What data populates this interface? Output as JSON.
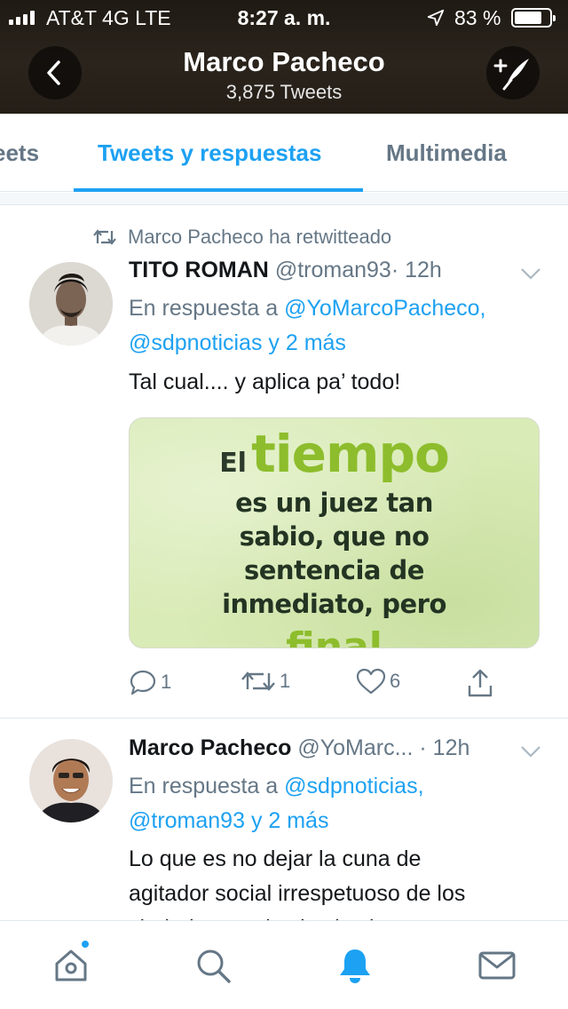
{
  "status_bar": {
    "carrier": "AT&T 4G  LTE",
    "time": "8:27 a. m.",
    "battery": "83 %",
    "battery_level": 0.83
  },
  "header": {
    "title": "Marco Pacheco",
    "subtitle": "3,875 Tweets",
    "back_icon": "chevron-left-icon",
    "compose_icon": "compose-feather-icon"
  },
  "tabs": [
    {
      "label": "eets",
      "active": false
    },
    {
      "label": "Tweets y respuestas",
      "active": true
    },
    {
      "label": "Multimedia",
      "active": false
    }
  ],
  "tweets": [
    {
      "retweet_label": "Marco Pacheco ha retwitteado",
      "name": "TITO ROMAN",
      "handle": "@troman93",
      "time": "· 12h",
      "reply_prefix": "En respuesta a ",
      "reply_mention_1": "@YoMarcoPacheco,",
      "reply_mention_2": "@sdpnoticias y 2 más",
      "text": "Tal cual.... y aplica pa’ todo!",
      "media": {
        "line_el": "El",
        "line_tiempo": "tiempo",
        "lines": [
          "es un juez tan",
          "sabio, que no",
          "sentencia de",
          "inmediato, pero"
        ],
        "cut": "final"
      },
      "actions": {
        "replies": "1",
        "retweets": "1",
        "likes": "6"
      }
    },
    {
      "name": "Marco Pacheco",
      "handle": "@YoMarc...",
      "time": "· 12h",
      "reply_prefix": "En respuesta a ",
      "reply_mention_1": "@sdpnoticias,",
      "reply_mention_2": "@troman93 y 2 más",
      "text_lines": [
        "Lo que es no dejar la cuna de",
        "agitador social irrespetuoso de los",
        "ciudadanos y las instituciones que"
      ]
    }
  ],
  "tab_bar": {
    "items": [
      "home-icon",
      "search-icon",
      "notifications-bell-icon",
      "messages-envelope-icon"
    ],
    "active_color": "#1da1f2",
    "inactive_color": "#657786"
  }
}
